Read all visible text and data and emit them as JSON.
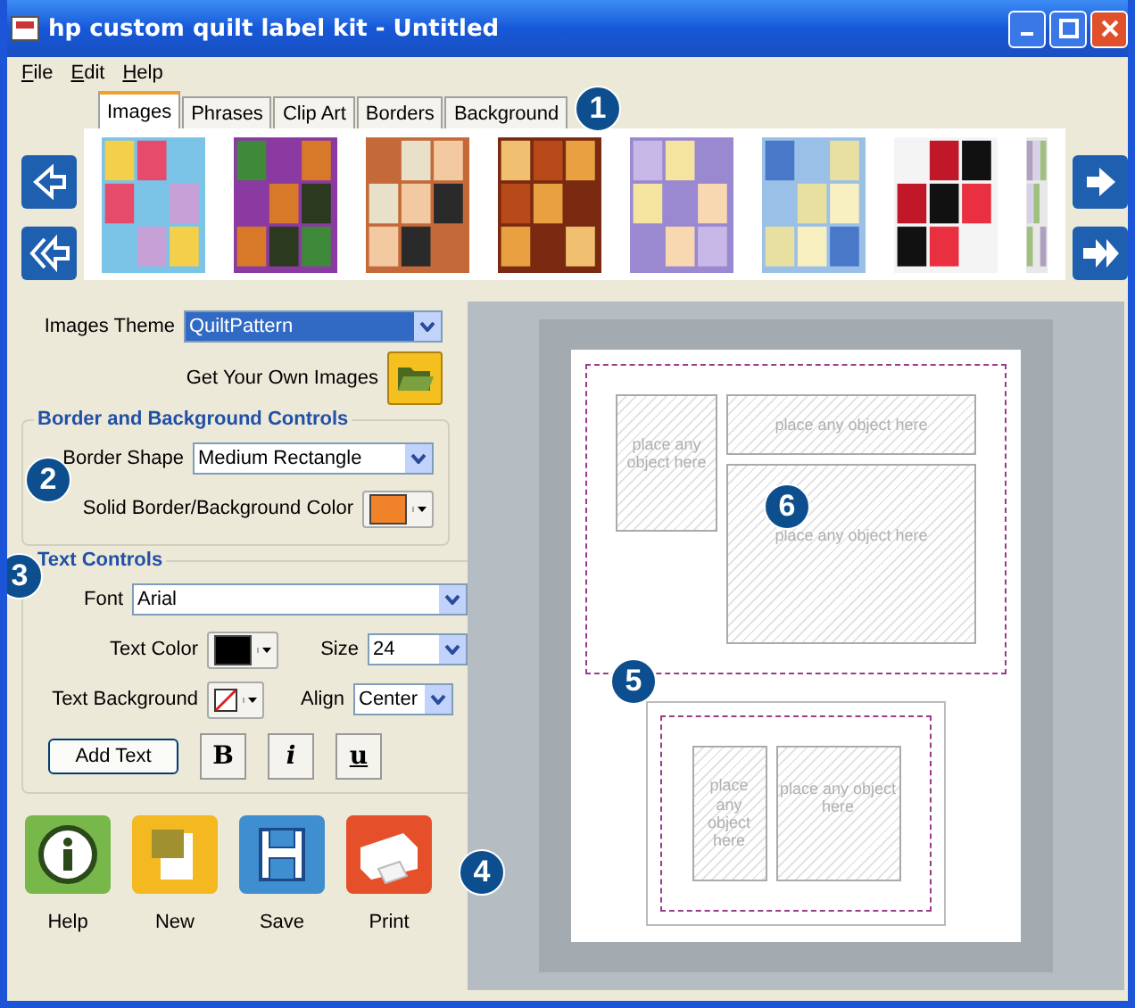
{
  "window": {
    "title": "hp custom quilt label kit - Untitled"
  },
  "menu": [
    {
      "label": "File"
    },
    {
      "label": "Edit"
    },
    {
      "label": "Help"
    }
  ],
  "tabs": [
    {
      "label": "Images",
      "selected": true
    },
    {
      "label": "Phrases",
      "selected": false
    },
    {
      "label": "Clip Art",
      "selected": false
    },
    {
      "label": "Borders",
      "selected": false
    },
    {
      "label": "Background",
      "selected": false
    }
  ],
  "images_theme": {
    "label": "Images Theme",
    "value": "QuiltPattern"
  },
  "own_images": {
    "label": "Get Your Own Images"
  },
  "border_controls": {
    "title": "Border and Background Controls",
    "shape_label": "Border Shape",
    "shape_value": "Medium Rectangle",
    "color_label": "Solid Border/Background Color",
    "color": "#f0822a"
  },
  "text_controls": {
    "title": "Text Controls",
    "font_label": "Font",
    "font_value": "Arial",
    "text_color": {
      "label": "Text Color",
      "color": "#000000"
    },
    "size_label": "Size",
    "size_value": "24",
    "background_label": "Text Background",
    "align_label": "Align",
    "align_value": "Center",
    "add_text": "Add Text",
    "bold": "B",
    "italic": "i",
    "underline": "u"
  },
  "actions": [
    {
      "kind": "help",
      "label": "Help"
    },
    {
      "kind": "new",
      "label": "New"
    },
    {
      "kind": "save",
      "label": "Save"
    },
    {
      "kind": "print",
      "label": "Print"
    }
  ],
  "label_top": {
    "placeholders": [
      "place any object here",
      "place any object here",
      "place any object here"
    ]
  },
  "label_bottom": {
    "placeholders": [
      "place any object here",
      "place any object here"
    ]
  },
  "callouts": [
    "1",
    "2",
    "3",
    "4",
    "5",
    "6"
  ]
}
